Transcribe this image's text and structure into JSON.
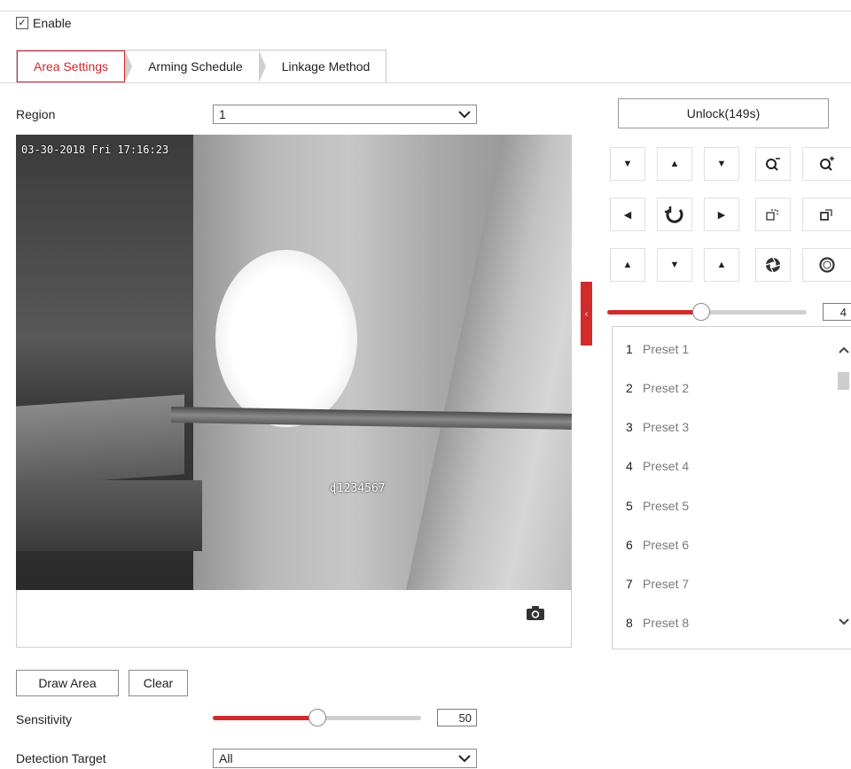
{
  "enable": {
    "label": "Enable",
    "checked": true
  },
  "tabs": [
    {
      "label": "Area Settings",
      "active": true
    },
    {
      "label": "Arming Schedule",
      "active": false
    },
    {
      "label": "Linkage Method",
      "active": false
    }
  ],
  "region": {
    "label": "Region",
    "value": "1"
  },
  "video": {
    "osd_time": "03-30-2018 Fri 17:16:23",
    "osd_name": "ɖ1234567"
  },
  "ptz": {
    "unlock_label": "Unlock(149s)",
    "speed": {
      "value": 4,
      "fraction": 0.47
    },
    "icons": [
      [
        "arrow-up-left-icon",
        "arrow-up-icon",
        "arrow-up-right-icon",
        "zoom-out-icon",
        "zoom-in-icon"
      ],
      [
        "arrow-left-icon",
        "auto-rotate-icon",
        "arrow-right-icon",
        "focus-near-icon",
        "focus-far-icon"
      ],
      [
        "arrow-down-left-icon",
        "arrow-down-icon",
        "arrow-down-right-icon",
        "iris-open-icon",
        "iris-close-icon"
      ]
    ],
    "presets": [
      {
        "num": "1",
        "name": "Preset 1"
      },
      {
        "num": "2",
        "name": "Preset 2"
      },
      {
        "num": "3",
        "name": "Preset 3"
      },
      {
        "num": "4",
        "name": "Preset 4"
      },
      {
        "num": "5",
        "name": "Preset 5"
      },
      {
        "num": "6",
        "name": "Preset 6"
      },
      {
        "num": "7",
        "name": "Preset 7"
      },
      {
        "num": "8",
        "name": "Preset 8"
      }
    ]
  },
  "buttons": {
    "draw_area": "Draw Area",
    "clear": "Clear"
  },
  "sensitivity": {
    "label": "Sensitivity",
    "value": "50",
    "fraction": 0.5
  },
  "detection_target": {
    "label": "Detection Target",
    "value": "All"
  },
  "colors": {
    "accent": "#d12b2b",
    "tab_active": "#d0262d"
  }
}
